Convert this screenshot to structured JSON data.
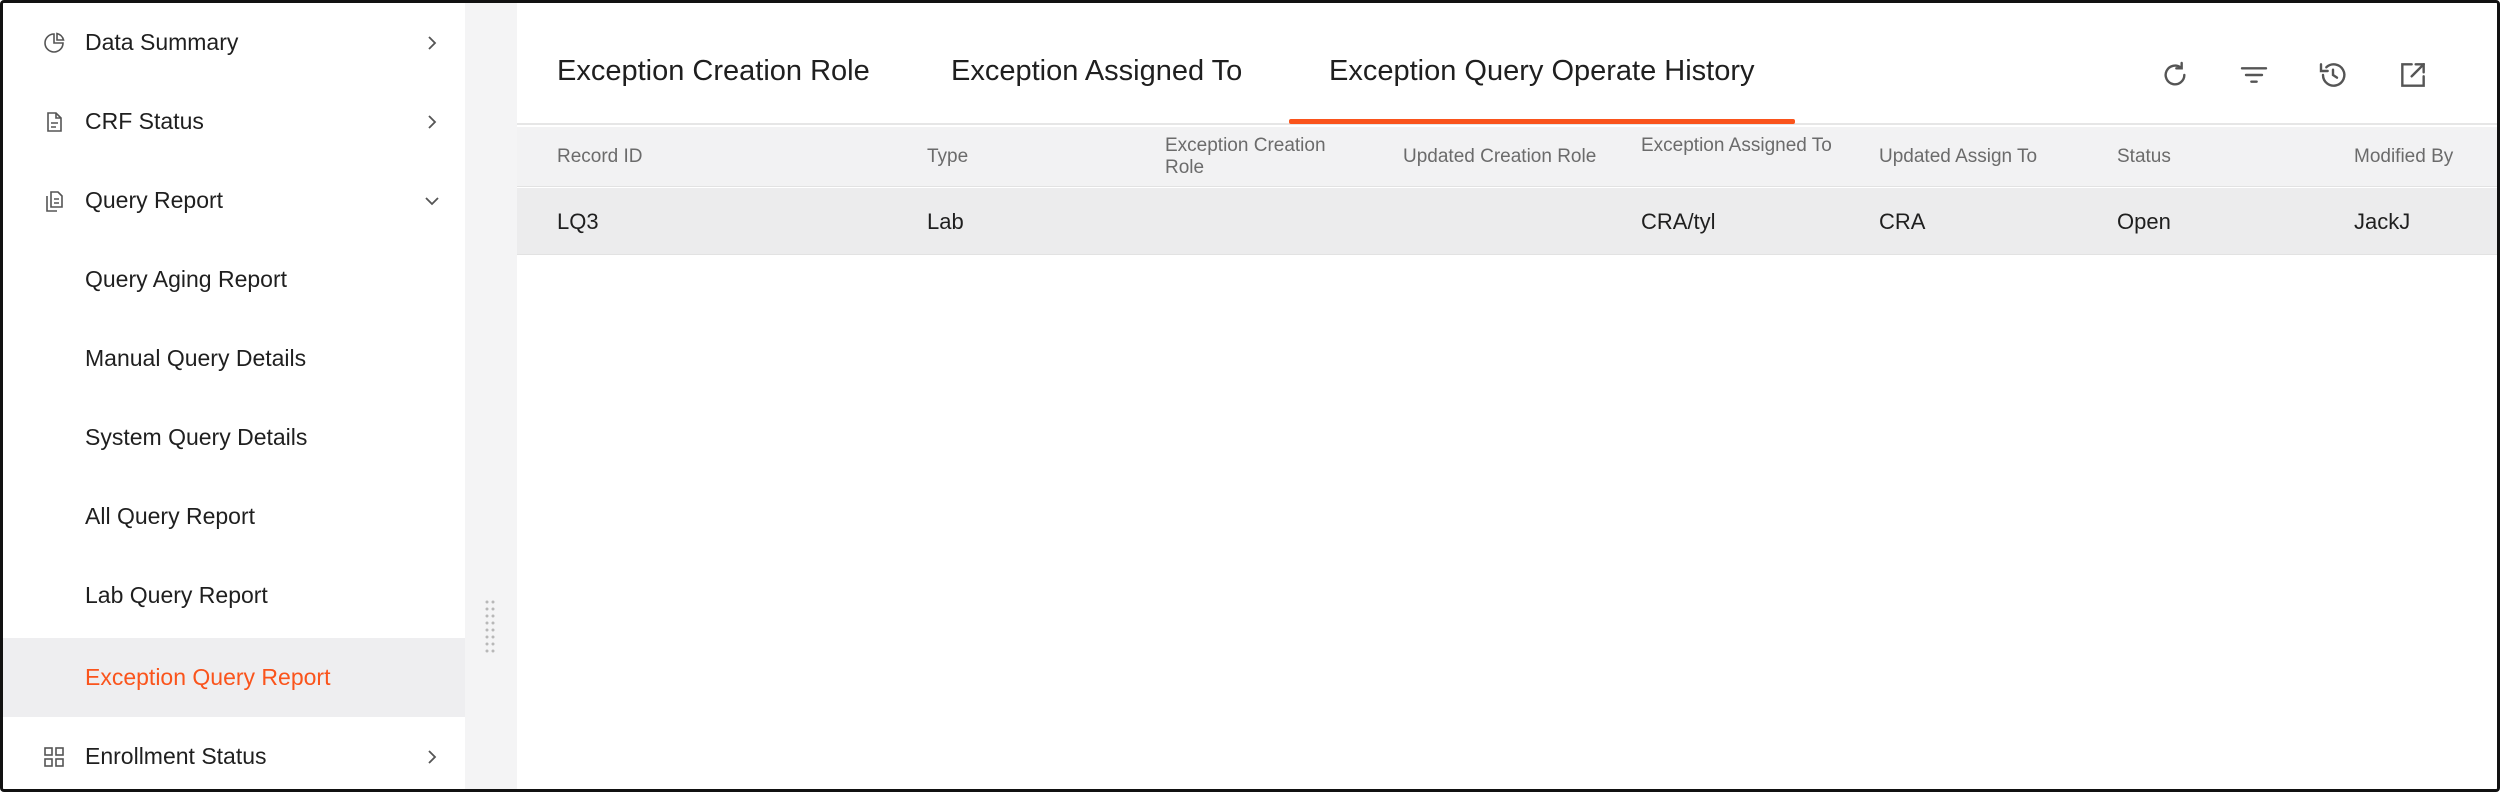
{
  "sidebar": {
    "items": [
      {
        "label": "Data Summary",
        "icon": "pie-chart-icon",
        "chevron": "right"
      },
      {
        "label": "CRF Status",
        "icon": "file-text-icon",
        "chevron": "right"
      },
      {
        "label": "Query Report",
        "icon": "copy-docs-icon",
        "chevron": "down"
      },
      {
        "label": "Query Aging Report"
      },
      {
        "label": "Manual Query Details"
      },
      {
        "label": "System Query Details"
      },
      {
        "label": "All Query Report"
      },
      {
        "label": "Lab Query Report"
      },
      {
        "label": "Exception Query Report",
        "active": true
      },
      {
        "label": "Enrollment Status",
        "icon": "grid-icon",
        "chevron": "right"
      }
    ]
  },
  "tabs": [
    {
      "label": "Exception Creation Role"
    },
    {
      "label": "Exception Assigned To"
    },
    {
      "label": "Exception Query Operate History",
      "active": true
    }
  ],
  "toolbar": {
    "icons": [
      "refresh-icon",
      "filter-icon",
      "history-icon",
      "export-icon"
    ]
  },
  "table": {
    "columns": [
      "Record ID",
      "Type",
      "Exception Creation Role",
      "Updated Creation Role",
      "Exception Assigned To",
      "Updated Assign To",
      "Status",
      "Modified By"
    ],
    "rows": [
      [
        "LQ3",
        "Lab",
        "",
        "",
        "CRA/tyl",
        "CRA",
        "Open",
        "JackJ"
      ]
    ]
  },
  "colors": {
    "accent": "#fa541c",
    "selected_bg": "#eeeef0"
  }
}
